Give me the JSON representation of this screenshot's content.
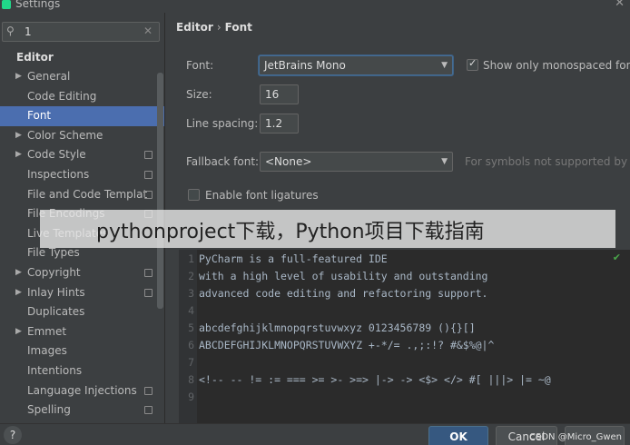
{
  "window": {
    "title": "Settings",
    "close_glyph": "✕"
  },
  "search": {
    "value": "1",
    "icon": "search-icon",
    "clear_glyph": "✕"
  },
  "sidebar": {
    "section": "Editor",
    "items": [
      {
        "label": "General",
        "arrow": true,
        "copy": false,
        "selected": false
      },
      {
        "label": "Code Editing",
        "arrow": false,
        "copy": false,
        "selected": false
      },
      {
        "label": "Font",
        "arrow": false,
        "copy": false,
        "selected": true
      },
      {
        "label": "Color Scheme",
        "arrow": true,
        "copy": false,
        "selected": false
      },
      {
        "label": "Code Style",
        "arrow": true,
        "copy": true,
        "selected": false
      },
      {
        "label": "Inspections",
        "arrow": false,
        "copy": true,
        "selected": false
      },
      {
        "label": "File and Code Templates",
        "arrow": false,
        "copy": true,
        "selected": false
      },
      {
        "label": "File Encodings",
        "arrow": false,
        "copy": true,
        "selected": false
      },
      {
        "label": "Live Templates",
        "arrow": false,
        "copy": false,
        "selected": false
      },
      {
        "label": "File Types",
        "arrow": false,
        "copy": false,
        "selected": false
      },
      {
        "label": "Copyright",
        "arrow": true,
        "copy": true,
        "selected": false
      },
      {
        "label": "Inlay Hints",
        "arrow": true,
        "copy": true,
        "selected": false
      },
      {
        "label": "Duplicates",
        "arrow": false,
        "copy": false,
        "selected": false
      },
      {
        "label": "Emmet",
        "arrow": true,
        "copy": false,
        "selected": false
      },
      {
        "label": "Images",
        "arrow": false,
        "copy": false,
        "selected": false
      },
      {
        "label": "Intentions",
        "arrow": false,
        "copy": false,
        "selected": false
      },
      {
        "label": "Language Injections",
        "arrow": false,
        "copy": true,
        "selected": false
      },
      {
        "label": "Spelling",
        "arrow": false,
        "copy": true,
        "selected": false
      }
    ]
  },
  "breadcrumb": {
    "parent": "Editor",
    "separator": "›",
    "current": "Font"
  },
  "font": {
    "font_label": "Font:",
    "font_value": "JetBrains Mono",
    "monospaced_label": "Show only monospaced fon",
    "monospaced_checked": true,
    "size_label": "Size:",
    "size_value": "16",
    "line_spacing_label": "Line spacing:",
    "line_spacing_value": "1.2",
    "fallback_label": "Fallback font:",
    "fallback_value": "<None>",
    "fallback_hint": "For symbols not supported by t",
    "ligatures_label": "Enable font ligatures",
    "ligatures_checked": false
  },
  "preview": {
    "lines": [
      {
        "n": "1",
        "text": "PyCharm is a full-featured IDE"
      },
      {
        "n": "2",
        "text": "with a high level of usability and outstanding"
      },
      {
        "n": "3",
        "text": "advanced code editing and refactoring support."
      },
      {
        "n": "4",
        "text": ""
      },
      {
        "n": "5",
        "text": "abcdefghijklmnopqrstuvwxyz 0123456789 (){}[]"
      },
      {
        "n": "6",
        "text": "ABCDEFGHIJKLMNOPQRSTUVWXYZ +-*/= .,;:!? #&$%@|^"
      },
      {
        "n": "7",
        "text": ""
      },
      {
        "n": "8",
        "text": "<!-- -- != := === >= >- >=> |-> -> <$> </> #[ |||> |= ~@"
      },
      {
        "n": "9",
        "text": ""
      }
    ]
  },
  "overlay_banner": "pythonproject下载，Python项目下载指南",
  "footer": {
    "help": "?",
    "ok": "OK",
    "cancel": "Cancel"
  },
  "watermark": "CSDN @Micro_Gwen",
  "colors": {
    "accent": "#4b6eaf",
    "ok_button": "#365880",
    "background": "#3c3f41"
  }
}
